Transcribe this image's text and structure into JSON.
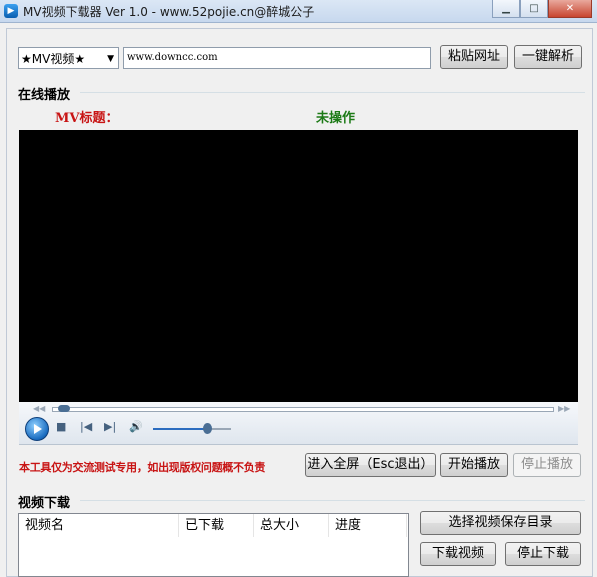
{
  "window": {
    "title": "MV视频下载器 Ver 1.0 - www.52pojie.cn@醉城公子",
    "controls": [
      "minimize",
      "maximize",
      "close"
    ]
  },
  "toolbar": {
    "source_select": "★MV视频★",
    "url_value": "www.downcc.com",
    "paste_button": "粘贴网址",
    "parse_button": "一键解析"
  },
  "online": {
    "section_label": "在线播放",
    "mv_title_label": "MV标题：",
    "status_text": "未操作"
  },
  "player": {
    "seek_position": 0.02,
    "volume_level": 0.7
  },
  "actions": {
    "disclaimer": "本工具仅为交流测试专用，如出现版权问题概不负责",
    "fullscreen_button": "进入全屏（Esc退出）",
    "play_button": "开始播放",
    "stop_button": "停止播放"
  },
  "download": {
    "section_label": "视频下载",
    "columns": [
      "视频名",
      "已下载",
      "总大小",
      "进度"
    ],
    "choose_dir_button": "选择视频保存目录",
    "download_button": "下载视频",
    "stop_download_button": "停止下载"
  },
  "colors": {
    "warning_red": "#c81414",
    "status_green": "#1c7a16",
    "video_bg": "#000000"
  }
}
